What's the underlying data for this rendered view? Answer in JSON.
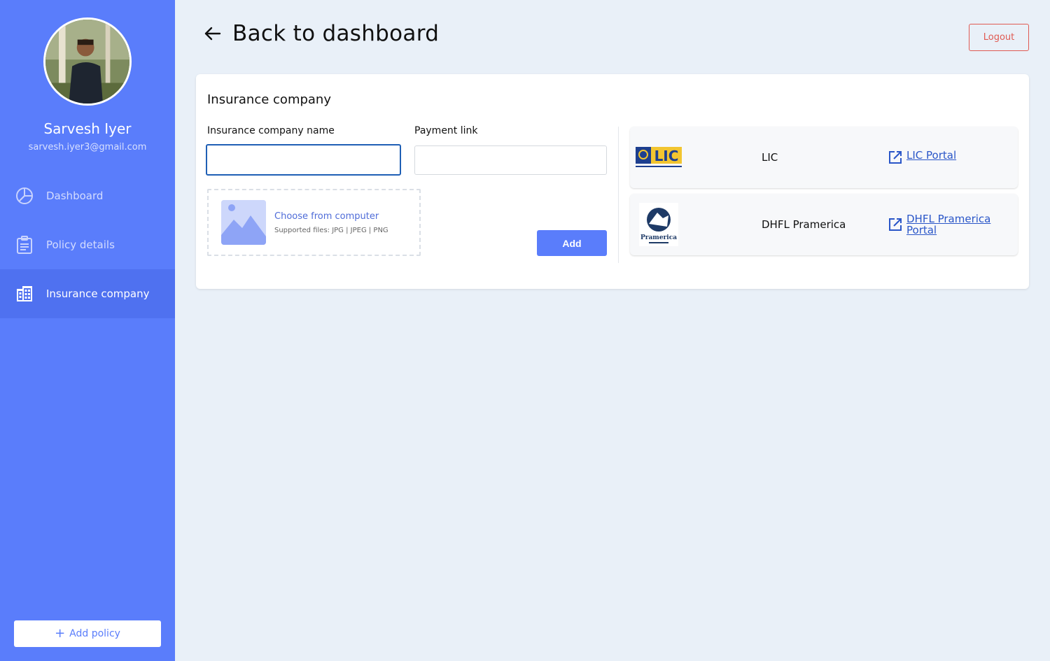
{
  "sidebar": {
    "user": {
      "name": "Sarvesh Iyer",
      "email": "sarvesh.iyer3@gmail.com"
    },
    "nav": [
      {
        "label": "Dashboard",
        "icon": "pie-chart-icon",
        "active": false
      },
      {
        "label": "Policy details",
        "icon": "clipboard-icon",
        "active": false
      },
      {
        "label": "Insurance company",
        "icon": "building-icon",
        "active": true
      }
    ],
    "add_policy_label": "Add policy"
  },
  "header": {
    "back_label": "Back to dashboard",
    "logout_label": "Logout"
  },
  "form": {
    "title": "Insurance company",
    "name_label": "Insurance company name",
    "name_value": "",
    "link_label": "Payment link",
    "link_value": "",
    "upload_title": "Choose from computer",
    "upload_sub": "Supported files: JPG | JPEG | PNG",
    "add_label": "Add"
  },
  "companies": [
    {
      "name": "LIC",
      "portal_label": "LIC Portal",
      "logo": "lic-logo"
    },
    {
      "name": "DHFL Pramerica",
      "portal_label": "DHFL Pramerica Portal",
      "logo": "pramerica-logo"
    }
  ],
  "colors": {
    "sidebar": "#5a7dfb",
    "active_nav": "#4f71f0",
    "background": "#e9f0f8",
    "logout": "#e05a52",
    "link": "#2a56c8"
  }
}
